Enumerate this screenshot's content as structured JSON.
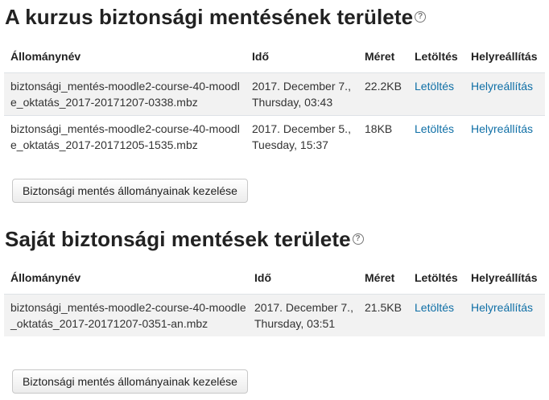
{
  "course_area": {
    "title": "A kurzus biztonsági mentésének területe",
    "help_icon": "help-circle-icon",
    "columns": [
      "Állománynév",
      "Idő",
      "Méret",
      "Letöltés",
      "Helyreállítás"
    ],
    "rows": [
      {
        "filename": "biztonsági_mentés-moodle2-course-40-moodle_oktatás_2017-20171207-0338.mbz",
        "time": "2017. December 7., Thursday, 03:43",
        "size": "22.2KB",
        "download": "Letöltés",
        "restore": "Helyreállítás"
      },
      {
        "filename": "biztonsági_mentés-moodle2-course-40-moodle_oktatás_2017-20171205-1535.mbz",
        "time": "2017. December 5., Tuesday, 15:37",
        "size": "18KB",
        "download": "Letöltés",
        "restore": "Helyreállítás"
      }
    ],
    "manage_button": "Biztonsági mentés állományainak kezelése"
  },
  "user_area": {
    "title": "Saját biztonsági mentések területe",
    "help_icon": "help-circle-icon",
    "columns": [
      "Állománynév",
      "Idő",
      "Méret",
      "Letöltés",
      "Helyreállítás"
    ],
    "rows": [
      {
        "filename": "biztonsági_mentés-moodle2-course-40-moodle_oktatás_2017-20171207-0351-an.mbz",
        "time": "2017. December 7., Thursday, 03:51",
        "size": "21.5KB",
        "download": "Letöltés",
        "restore": "Helyreállítás"
      }
    ],
    "manage_button": "Biztonsági mentés állományainak kezelése"
  },
  "colors": {
    "link": "#0f6fa6",
    "stripe": "#f2f2f2",
    "text": "#222222"
  }
}
